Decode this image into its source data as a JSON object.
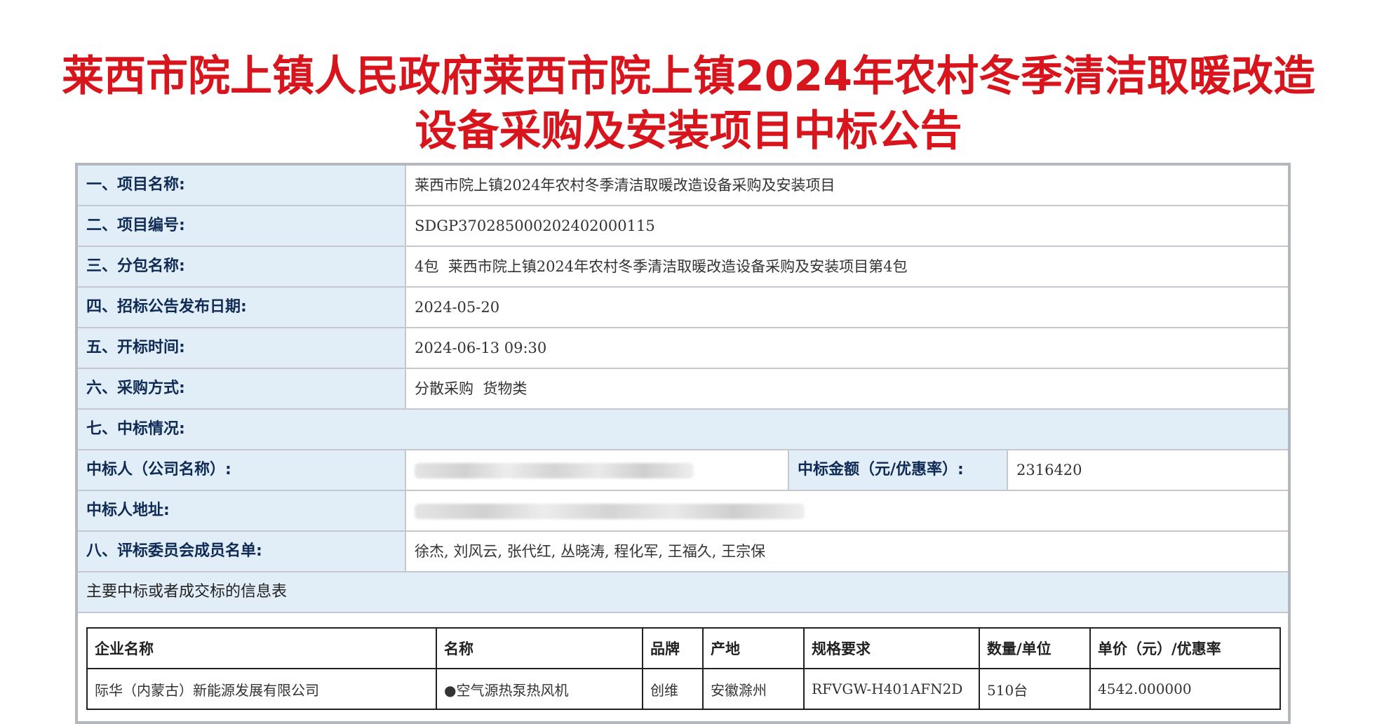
{
  "title": {
    "line1": "莱西市院上镇人民政府莱西市院上镇2024年农村冬季清洁取暖改造",
    "line2": "设备采购及安装项目中标公告"
  },
  "fields": [
    {
      "label": "一、项目名称:",
      "value": "莱西市院上镇2024年农村冬季清洁取暖改造设备采购及安装项目"
    },
    {
      "label": "二、项目编号:",
      "value": "SDGP370285000202402000115"
    },
    {
      "label": "三、分包名称:",
      "value": "4包  莱西市院上镇2024年农村冬季清洁取暖改造设备采购及安装项目第4包"
    },
    {
      "label": "四、招标公告发布日期:",
      "value": "2024-05-20"
    },
    {
      "label": "五、开标时间:",
      "value": "2024-06-13 09:30"
    },
    {
      "label": "六、采购方式:",
      "value": "分散采购  货物类"
    }
  ],
  "award": {
    "section_label": "七、中标情况:",
    "winner_label": "中标人（公司名称）:",
    "amount_label": "中标金额（元/优惠率）:",
    "amount_value": "2316420",
    "address_label": "中标人地址:"
  },
  "committee": {
    "label": "八、评标委员会成员名单:",
    "value": "徐杰, 刘风云, 张代红, 丛晓涛, 程化军, 王福久, 王宗保"
  },
  "items_table": {
    "caption": "主要中标或者成交标的信息表",
    "headers": [
      "企业名称",
      "名称",
      "品牌",
      "产地",
      "规格要求",
      "数量/单位",
      "单价（元）/优惠率"
    ],
    "rows": [
      [
        "际华（内蒙古）新能源发展有限公司",
        "●空气源热泵热风机",
        "创维",
        "安徽滁州",
        "RFVGW-H401AFN2D",
        "510台",
        "4542.000000"
      ]
    ]
  },
  "colors": {
    "title_red": "#d8141c",
    "label_bg": "#e2eef7",
    "label_text": "#0f2a55",
    "frame_border": "#b3b8bd"
  }
}
